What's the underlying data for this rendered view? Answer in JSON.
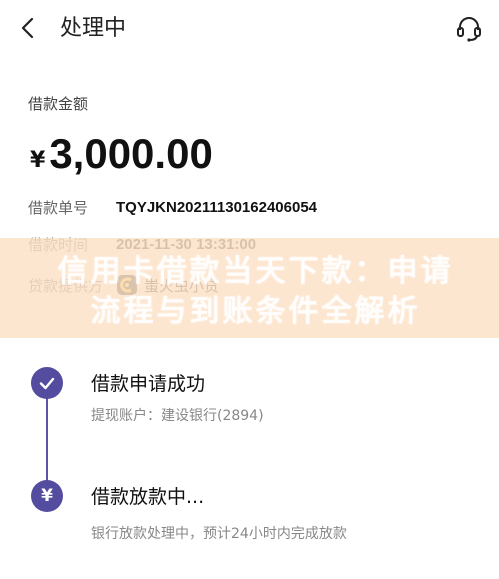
{
  "header": {
    "title": "处理中",
    "back_icon": "chevron-left-icon",
    "service_icon": "customer-service-icon"
  },
  "amount": {
    "label": "借款金额",
    "currency": "¥",
    "value": "3,000.00"
  },
  "details": [
    {
      "label": "借款单号",
      "value": "TQYJKN20211130162406054"
    },
    {
      "label": "借款时间",
      "value": "2021-11-30 13:31:00"
    },
    {
      "label": "贷款提供方",
      "value": "蚩火虫小贷"
    }
  ],
  "watermark": {
    "text": "信用卡借款当天下款：申请流程与到账条件全解析"
  },
  "steps": [
    {
      "title": "借款申请成功",
      "subtitle": "提现账户：建设银行(2894)",
      "icon": "check-icon"
    },
    {
      "title": "借款放款中...",
      "subtitle": "银行放款处理中，预计24小时内完成放款",
      "icon": "yuan-icon"
    }
  ],
  "colors": {
    "accent": "#544c9e",
    "watermark_bg": "#fde2c8"
  }
}
